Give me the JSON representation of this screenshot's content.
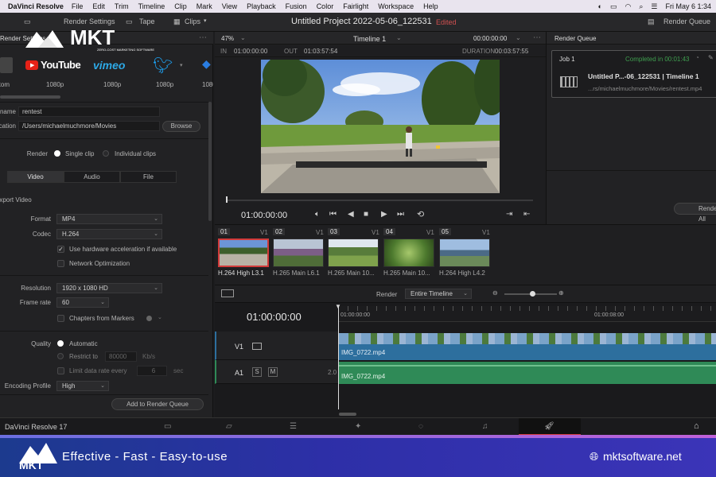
{
  "menubar": {
    "app": "DaVinci Resolve",
    "items": [
      "File",
      "Edit",
      "Trim",
      "Timeline",
      "Clip",
      "Mark",
      "View",
      "Playback",
      "Fusion",
      "Color",
      "Fairlight",
      "Workspace",
      "Help"
    ],
    "clock": "Fri May 6  1:34"
  },
  "toolbar": {
    "render_settings": "Render Settings",
    "tape": "Tape",
    "clips": "Clips",
    "project_title": "Untitled Project 2022-05-06_122531",
    "edited": "Edited",
    "render_queue": "Render Queue"
  },
  "watermark": {
    "logo": "MKT",
    "tagline": "ZERO-COST MARKETING SOFTWARE"
  },
  "left": {
    "header": "Render Settings",
    "presets": [
      {
        "name": "YouTube",
        "res": "1080p"
      },
      {
        "name": "vimeo",
        "res": "1080p"
      },
      {
        "name": "twitter",
        "res": "1080p"
      },
      {
        "name": "dropbox",
        "res": "1080p"
      }
    ],
    "custom_res": "Custom",
    "name_label": "Filename",
    "name_value": "rentest",
    "location_label": "Location",
    "location_value": "/Users/michaelmuchmore/Movies",
    "browse": "Browse",
    "render_label": "Render",
    "single_clip": "Single clip",
    "individual_clips": "Individual clips",
    "tabs": [
      "Video",
      "Audio",
      "File"
    ],
    "export_video": "Export Video",
    "format_label": "Format",
    "format_value": "MP4",
    "codec_label": "Codec",
    "codec_value": "H.264",
    "hw_accel": "Use hardware acceleration if available",
    "network_opt": "Network Optimization",
    "resolution_label": "Resolution",
    "resolution_value": "1920 x 1080 HD",
    "framerate_label": "Frame rate",
    "framerate_value": "60",
    "chapters": "Chapters from Markers",
    "quality_label": "Quality",
    "automatic": "Automatic",
    "restrict_to": "Restrict to",
    "restrict_value": "80000",
    "kbs": "Kb/s",
    "limit_rate": "Limit data rate every",
    "limit_value": "6",
    "sec": "sec",
    "encoding_label": "Encoding Profile",
    "encoding_value": "High",
    "add_queue": "Add to Render Queue"
  },
  "viewer": {
    "zoom": "47%",
    "timeline_name": "Timeline 1",
    "tc_top": "00:00:00:00",
    "in_label": "IN",
    "in_value": "01:00:00:00",
    "out_label": "OUT",
    "out_value": "01:03:57:54",
    "duration_label": "DURATION",
    "duration_value": "00:03:57:55",
    "current_tc": "01:00:00:00"
  },
  "render_queue": {
    "title": "Render Queue",
    "job": "Job 1",
    "completed": "Completed in 00:01:43",
    "job_title": "Untitled P...-06_122531 | Timeline 1",
    "job_path": "...rs/michaelmuchmore/Movies/rentest.mp4",
    "render_all": "Render All"
  },
  "clips": [
    {
      "num": "01",
      "track": "V1",
      "codec": "H.264 High L3.1"
    },
    {
      "num": "02",
      "track": "V1",
      "codec": "H.265 Main L6.1"
    },
    {
      "num": "03",
      "track": "V1",
      "codec": "H.265 Main 10..."
    },
    {
      "num": "04",
      "track": "V1",
      "codec": "H.265 Main 10..."
    },
    {
      "num": "05",
      "track": "V1",
      "codec": "H.264 High L4.2"
    }
  ],
  "timeline": {
    "render_label": "Render",
    "render_scope": "Entire Timeline",
    "timecode": "01:00:00:00",
    "ruler": [
      "01:00:00:00",
      "01:00:08:00"
    ],
    "v1": "V1",
    "a1": "A1",
    "a1_level": "2.0",
    "s": "S",
    "m": "M",
    "video_clip": "IMG_0722.mp4",
    "audio_clip": "IMG_0722.mp4"
  },
  "pagebar": {
    "app_version": "DaVinci Resolve 17"
  },
  "banner": {
    "logo": "MKT",
    "slogan": "Effective - Fast - Easy-to-use",
    "site": "mktsoftware.net"
  },
  "colors": {
    "accent_red": "#d23b3b",
    "video_track": "#2d6f9e",
    "audio_track": "#2f8a57",
    "banner_start": "#1c3a8e",
    "banner_end": "#3b34b8"
  }
}
